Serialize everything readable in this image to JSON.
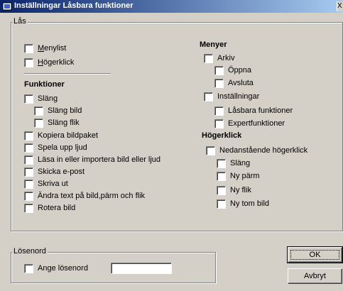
{
  "window": {
    "title": "Inställningar Låsbara funktioner",
    "close": "X"
  },
  "las_group": {
    "title": "Lås"
  },
  "left": {
    "menylist_prefix": "M",
    "menylist_rest": "enylist",
    "hogerklick_prefix": "H",
    "hogerklick_rest": "ögerklick",
    "funktioner_header": "Funktioner",
    "slang": "Släng",
    "slang_bild": "Släng bild",
    "slang_flik": "Släng flik",
    "kopiera": "Kopiera bildpaket",
    "spela": "Spela upp ljud",
    "lasa": "Läsa in eller importera bild eller ljud",
    "skicka": "Skicka e-post",
    "skriva": "Skriva ut",
    "andra": "Ändra text på bild,pärm och flik",
    "rotera": "Rotera bild"
  },
  "right": {
    "menyer_header": "Menyer",
    "arkiv": "Arkiv",
    "oppna": "Öppna",
    "avsluta": "Avsluta",
    "installningar": "Inställningar",
    "lasbara": "Låsbara funktioner",
    "expert": "Expertfunktioner",
    "hogerklick_header": "Högerklick",
    "nedanstaende": "Nedanstående högerklick",
    "slang": "Släng",
    "ny_parm": "Ny pärm",
    "ny_flik": "Ny flik",
    "ny_tom_bild": "Ny tom bild"
  },
  "losenord_group": {
    "title": "Lösenord",
    "ange": "Ange lösenord",
    "value": ""
  },
  "buttons": {
    "ok": "OK",
    "avbryt": "Avbryt"
  }
}
